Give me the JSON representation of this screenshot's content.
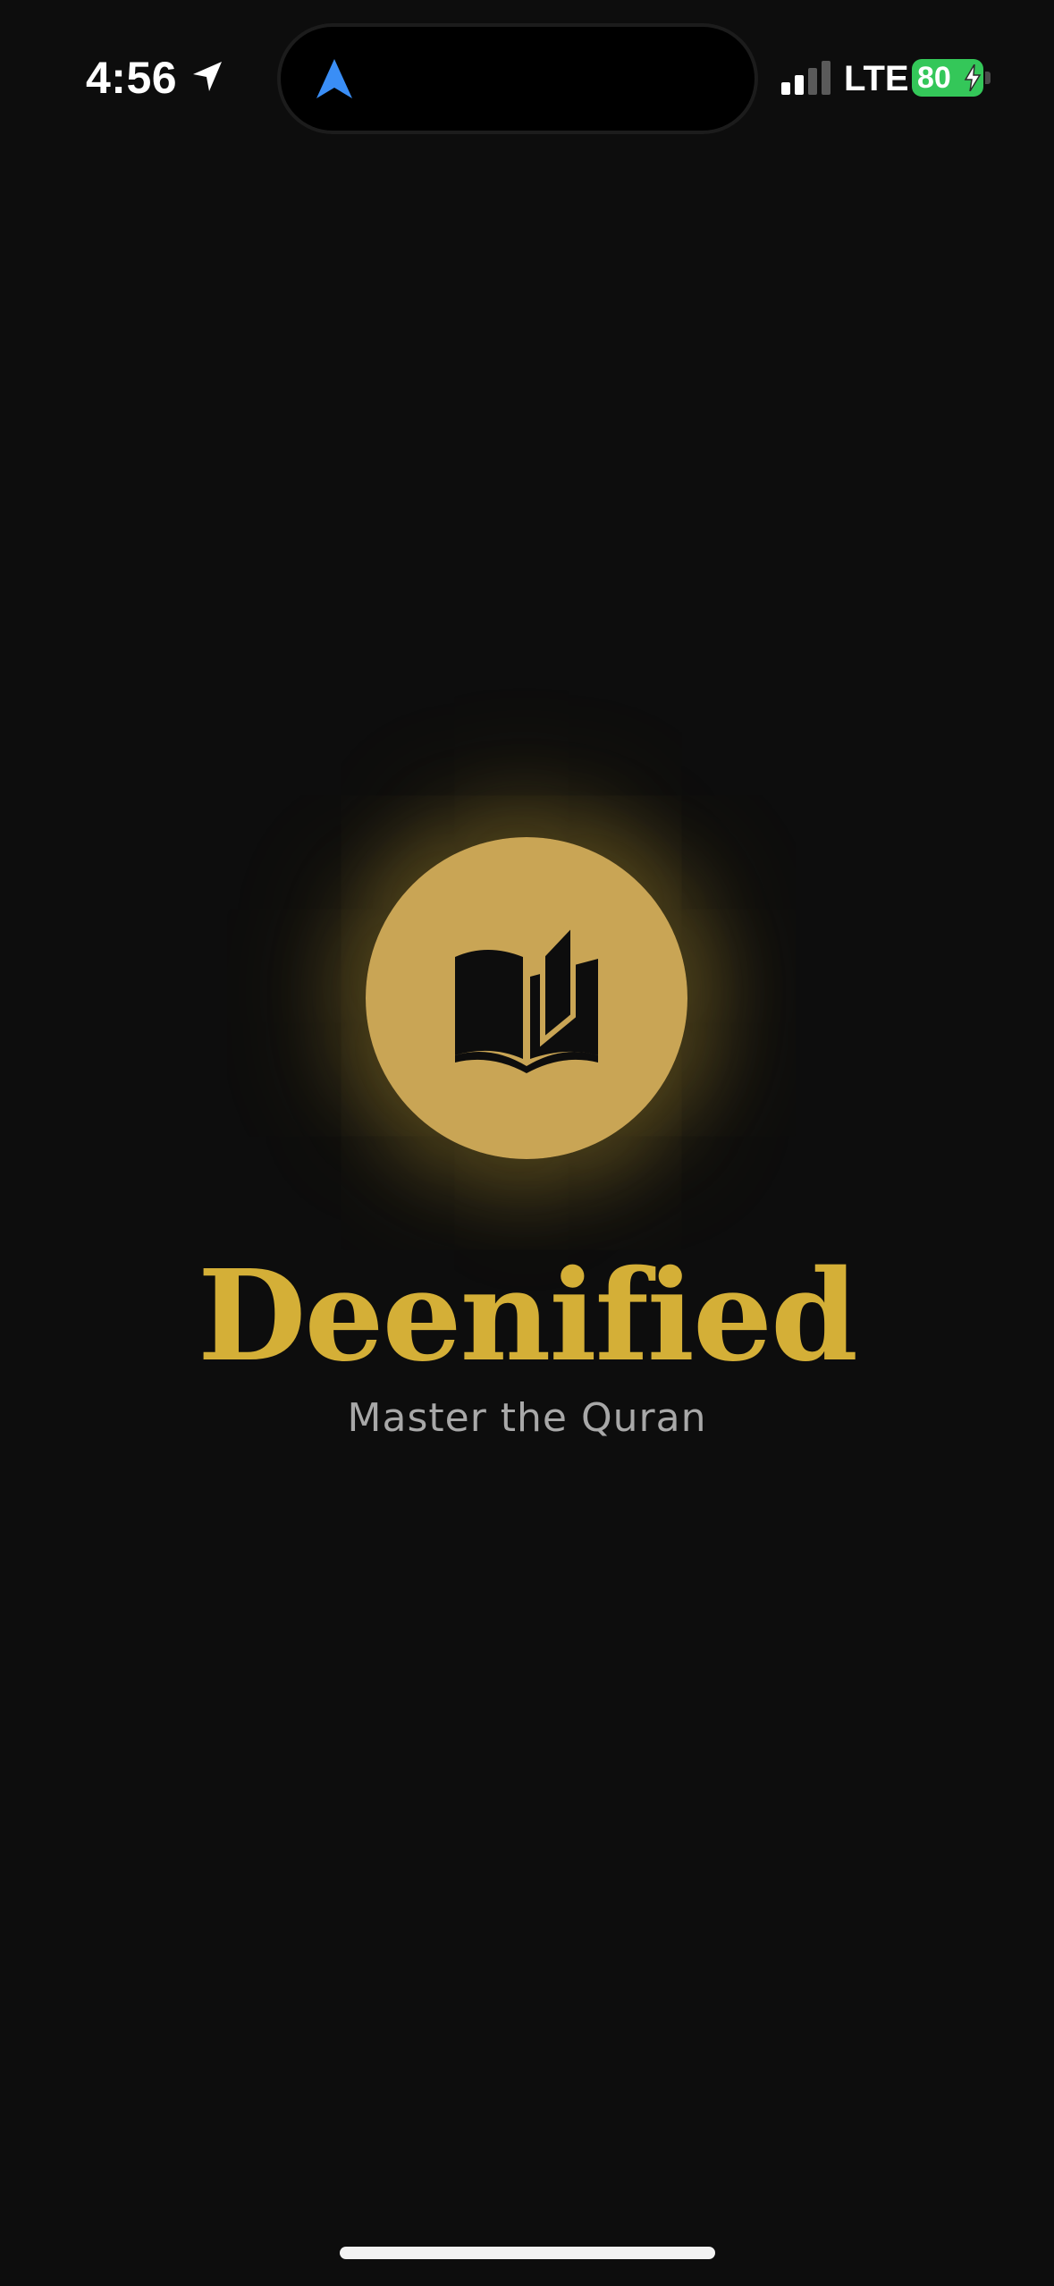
{
  "status_bar": {
    "time": "4:56",
    "network": "LTE",
    "battery_level": "80",
    "battery_color": "#34c759",
    "location_icon": "location-arrow-icon",
    "island_icon": "navigation-arrow-icon"
  },
  "splash": {
    "logo_icon": "open-book-icon",
    "title": "Deenified",
    "subtitle": "Master the Quran",
    "accent_color": "#d4af37",
    "circle_color": "#c9a555"
  }
}
